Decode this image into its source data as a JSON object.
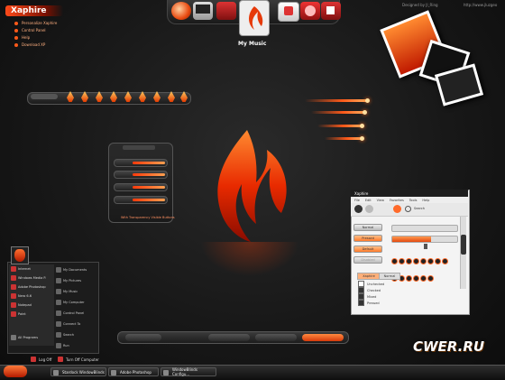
{
  "branding": {
    "logo_text": "Xaphire",
    "menu": [
      "Personalize Xaphire",
      "Control Panel",
      "Help",
      "Download XP"
    ],
    "designed_by": "Designed by Jl_Ring",
    "url": "http://www.jluzgeo"
  },
  "dock": {
    "caption": "My Music",
    "icons": [
      "globe-icon",
      "monitor-icon",
      "music-icon",
      "drive-icon",
      "cd-icon",
      "folder-icon"
    ]
  },
  "panel": {
    "caption": "With Transparency Visible Buttons"
  },
  "start_menu": {
    "left_items": [
      "Internet",
      "Windows Media P.",
      "Adobe Photoshop",
      "Nero 6.6",
      "Notepad",
      "Paint",
      "All Programs"
    ],
    "right_items": [
      "My Documents",
      "My Pictures",
      "My Music",
      "My Computer",
      "Control Panel",
      "Connect To",
      "Search",
      "Run"
    ],
    "logoff": "Log Off",
    "turnoff": "Turn Off Computer"
  },
  "taskbar": {
    "items": [
      "Stardock WindowBlinds",
      "Adobe Photoshop",
      "WindowBlinds Configu..."
    ]
  },
  "window": {
    "title": "Xaphire",
    "menu": [
      "File",
      "Edit",
      "View",
      "Favorites",
      "Tools",
      "Help"
    ],
    "toolbar_search": "Search",
    "buttons": [
      "Normal",
      "Pressed",
      "Default",
      "Disabled"
    ],
    "tabs": [
      "Xaphire",
      "Normal"
    ],
    "checks": [
      "Unchecked",
      "Checked",
      "Mixed",
      "Pressed"
    ],
    "slider_fill": 0.6
  },
  "watermark": "CWER.RU",
  "colors": {
    "accent": "#ff5a1a",
    "accent_dark": "#b32000",
    "background": "#1a1a1a"
  }
}
